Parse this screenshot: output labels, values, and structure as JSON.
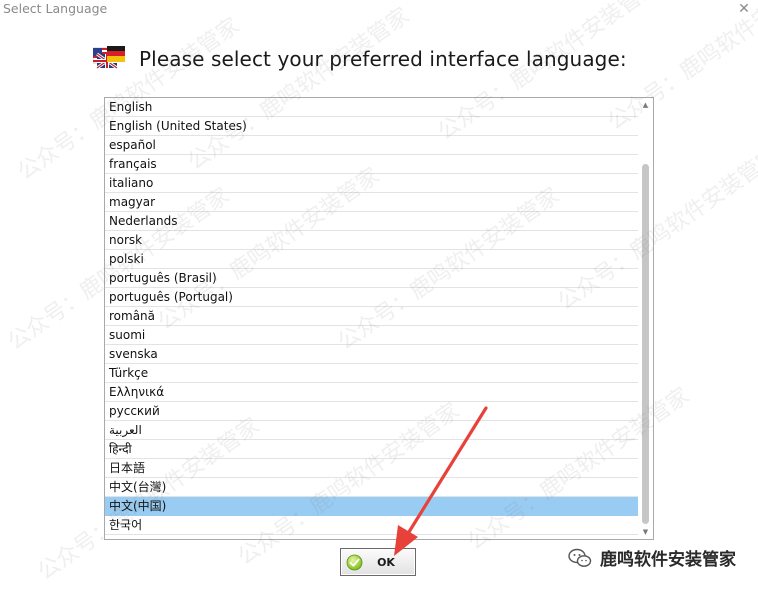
{
  "window": {
    "title": "Select Language",
    "close_glyph": "✕"
  },
  "header": {
    "prompt": "Please select your preferred interface language:",
    "icon": "flag-icon"
  },
  "languages": [
    "English",
    "English (United States)",
    "español",
    "français",
    "italiano",
    "magyar",
    "Nederlands",
    "norsk",
    "polski",
    "português (Brasil)",
    "português (Portugal)",
    "română",
    "suomi",
    "svenska",
    "Türkçe",
    "Ελληνικά",
    "русский",
    "العربية",
    "हिन्दी",
    "日本語",
    "中文(台灣)",
    "中文(中国)",
    "한국어"
  ],
  "selected_language": "中文(中国)",
  "scrollbar": {
    "up_glyph": "▲",
    "down_glyph": "▼"
  },
  "ok_button": {
    "label": "OK",
    "icon": "check-icon"
  },
  "watermark": {
    "text": "公众号：鹿鸣软件安装管家"
  },
  "account": {
    "label": "鹿鸣软件安装管家",
    "icon": "wechat-icon"
  },
  "colors": {
    "selection": "#99ccf2",
    "arrow": "#e8413a"
  }
}
